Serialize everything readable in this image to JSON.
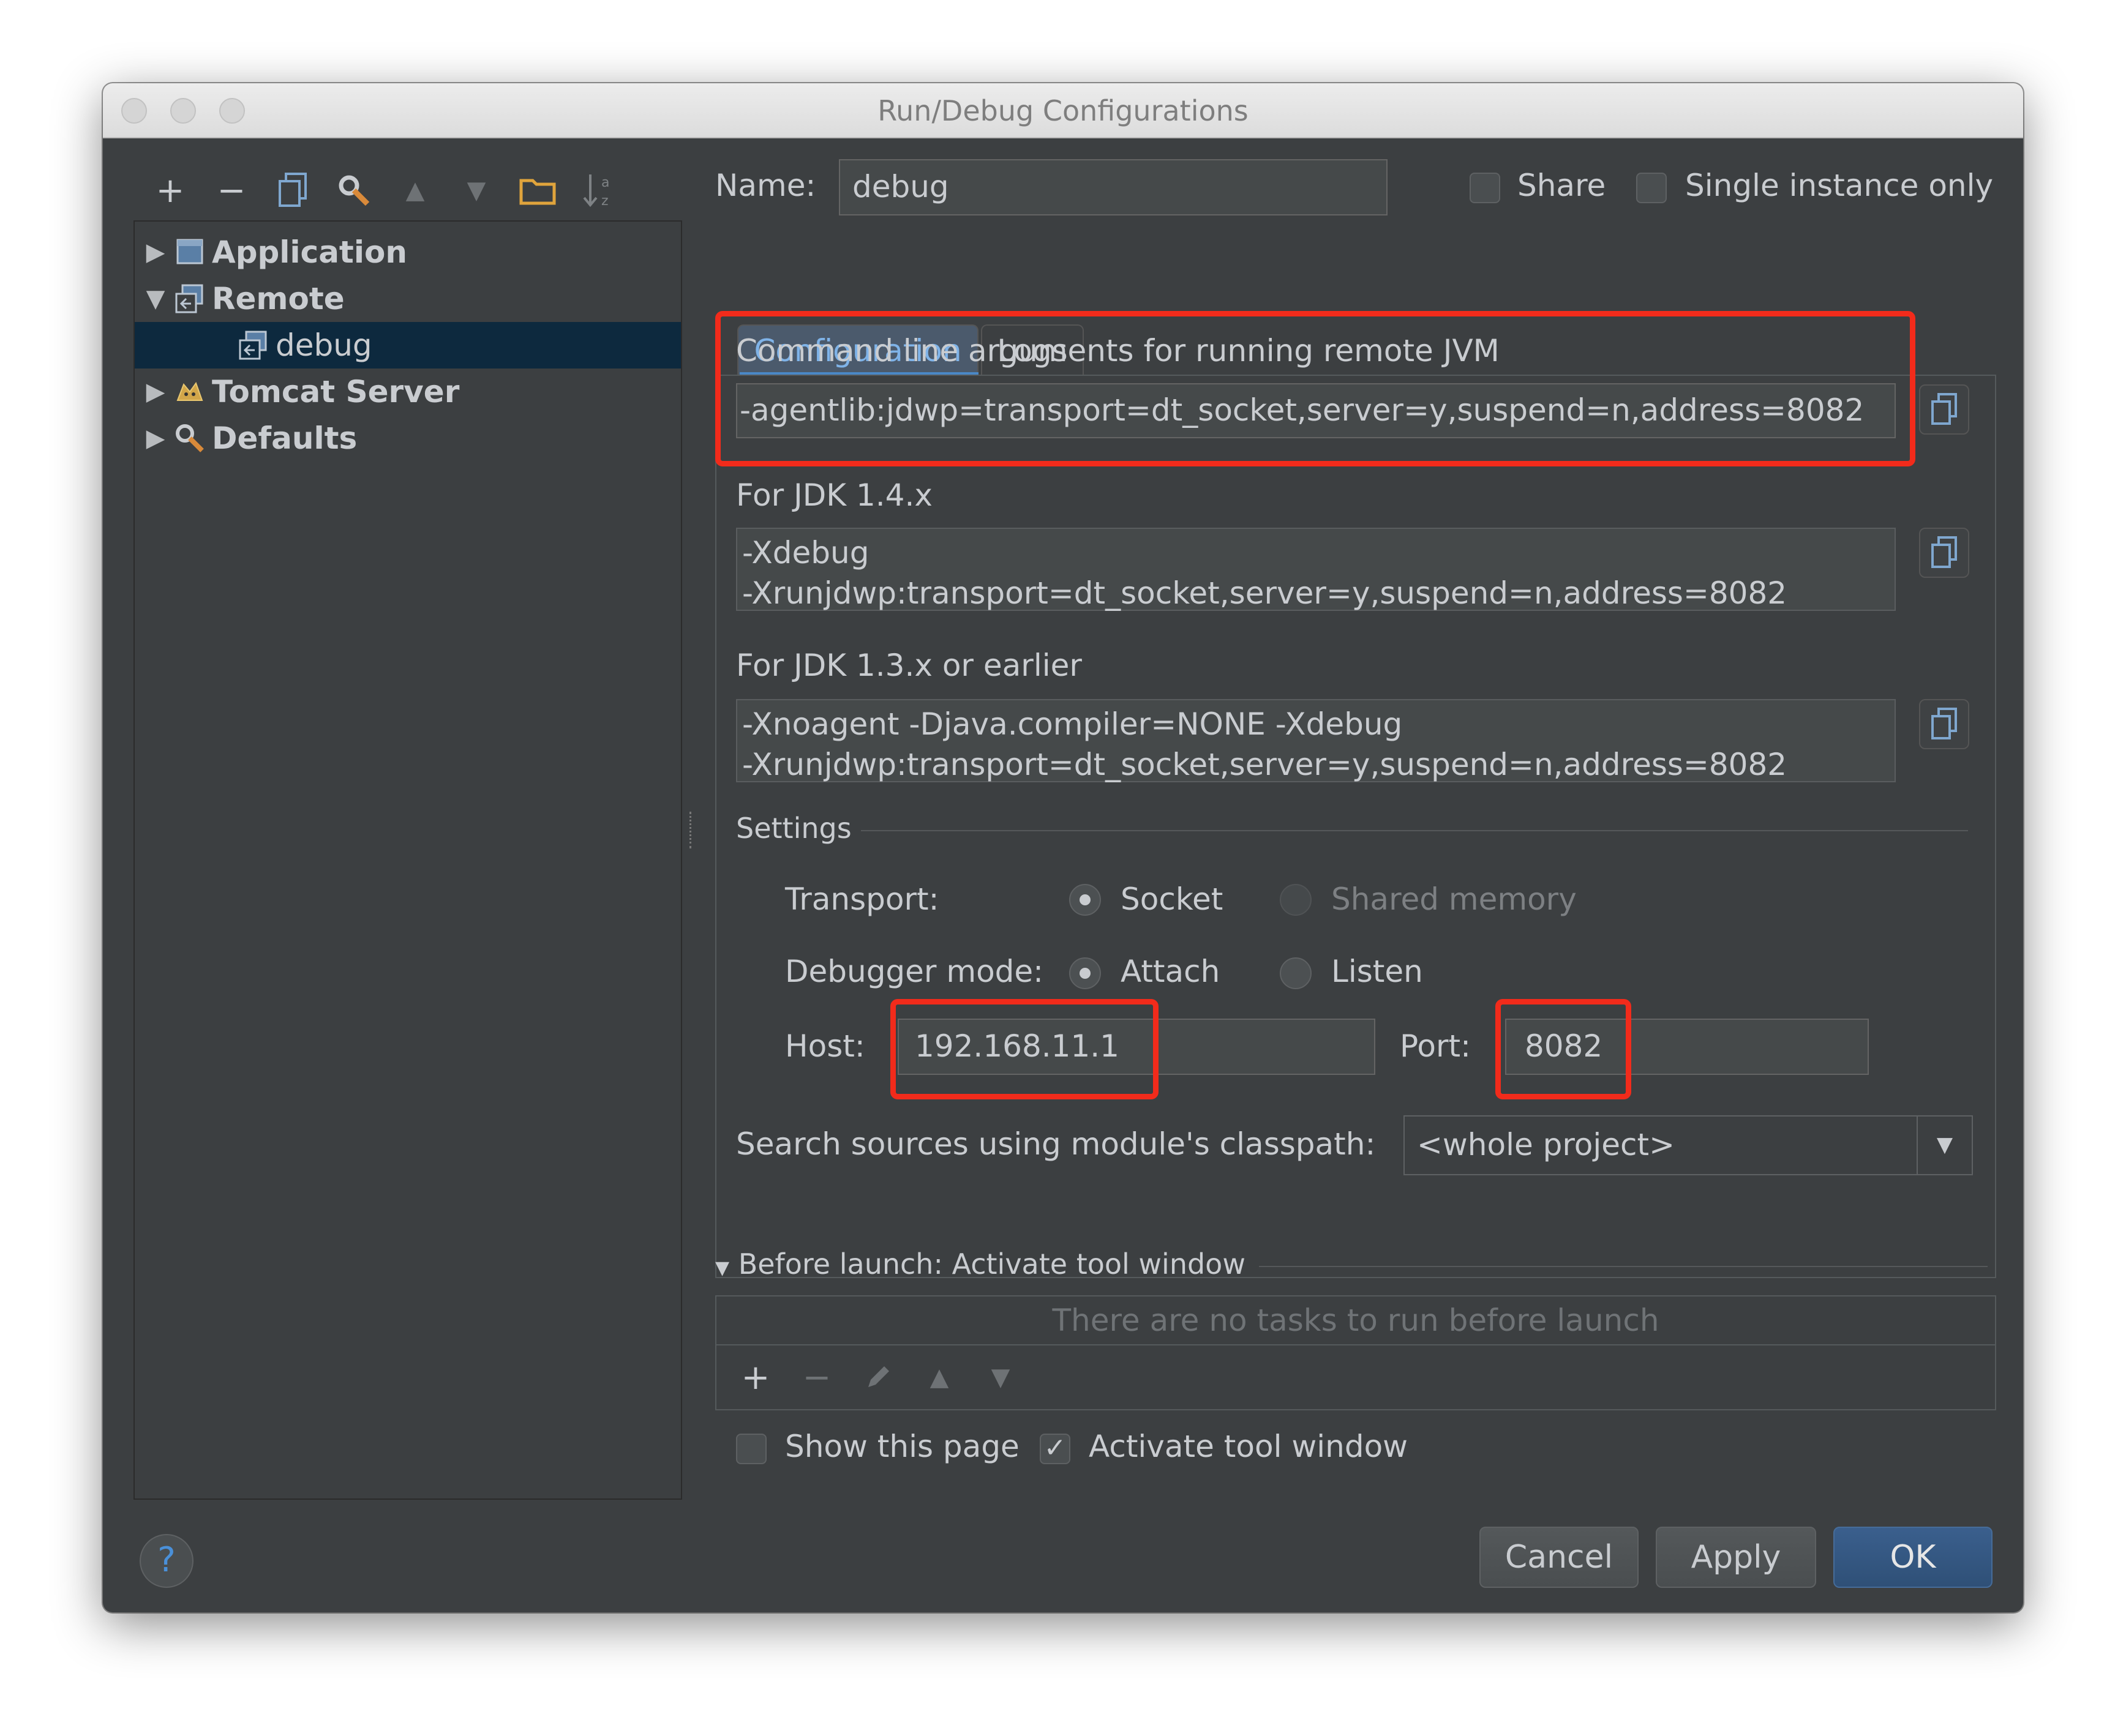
{
  "window": {
    "title": "Run/Debug Configurations"
  },
  "toolbar": {
    "add": "+",
    "remove": "−",
    "up": "▲",
    "down": "▼"
  },
  "tree": {
    "items": [
      {
        "label": "Application"
      },
      {
        "label": "Remote"
      },
      {
        "label": "debug"
      },
      {
        "label": "Tomcat Server"
      },
      {
        "label": "Defaults"
      }
    ]
  },
  "name_row": {
    "label": "Name:",
    "value": "debug",
    "share_label": "Share",
    "single_instance_label": "Single instance only"
  },
  "tabs": [
    {
      "label": "Configuration"
    },
    {
      "label": "Logs"
    }
  ],
  "config": {
    "cmd_label": "Command line arguments for running remote JVM",
    "cmd_value": "-agentlib:jdwp=transport=dt_socket,server=y,suspend=n,address=8082",
    "jdk14_label": "For JDK 1.4.x",
    "jdk14_line1": "-Xdebug",
    "jdk14_line2": "-Xrunjdwp:transport=dt_socket,server=y,suspend=n,address=8082",
    "jdk13_label": "For JDK 1.3.x or earlier",
    "jdk13_line1": "-Xnoagent -Djava.compiler=NONE -Xdebug",
    "jdk13_line2": "-Xrunjdwp:transport=dt_socket,server=y,suspend=n,address=8082"
  },
  "settings": {
    "title": "Settings",
    "transport_label": "Transport:",
    "socket": "Socket",
    "shared_memory": "Shared memory",
    "debugger_mode_label": "Debugger mode:",
    "attach": "Attach",
    "listen": "Listen",
    "host_label": "Host:",
    "host_value": "192.168.11.1",
    "port_label": "Port:",
    "port_value": "8082",
    "classpath_label": "Search sources using module's classpath:",
    "classpath_value": "<whole project>"
  },
  "before_launch": {
    "title": "Before launch: Activate tool window",
    "empty": "There are no tasks to run before launch",
    "add": "+",
    "remove": "−",
    "up": "▲",
    "down": "▼",
    "show_page": "Show this page",
    "activate_tool_window": "Activate tool window"
  },
  "buttons": {
    "help": "?",
    "cancel": "Cancel",
    "apply": "Apply",
    "ok": "OK"
  }
}
